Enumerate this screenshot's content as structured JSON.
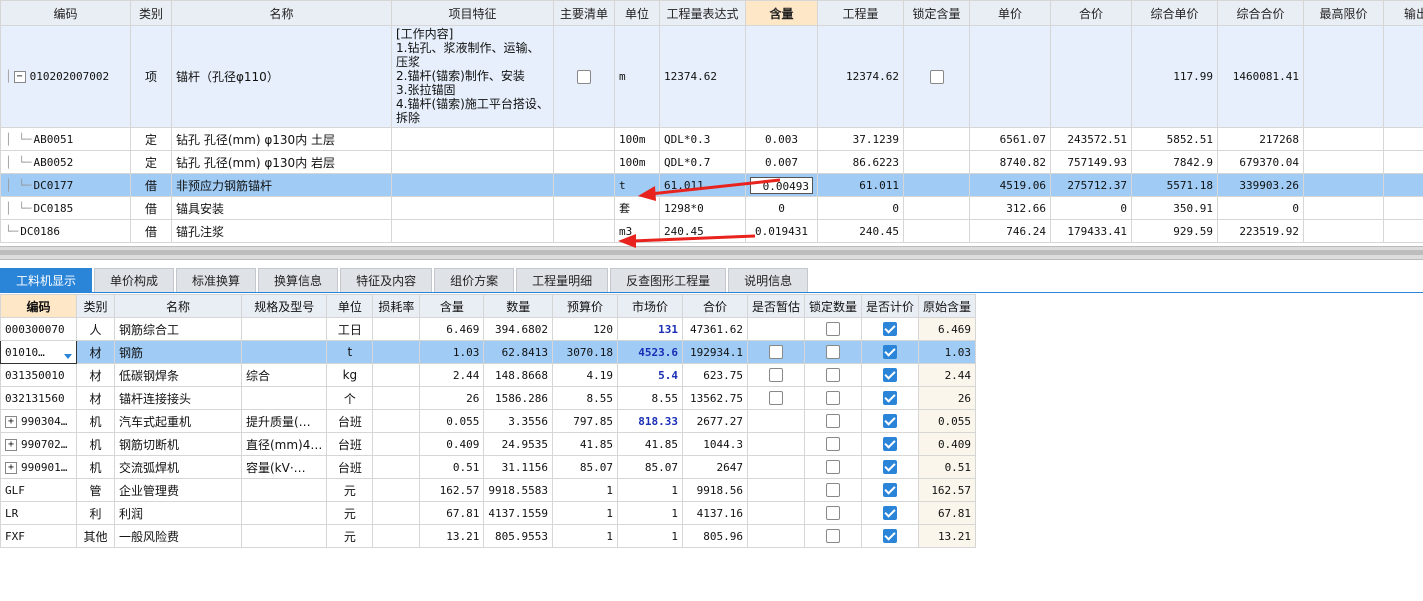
{
  "upper": {
    "headers": [
      "编码",
      "类别",
      "名称",
      "项目特征",
      "主要清单",
      "单位",
      "工程量表达式",
      "含量",
      "工程量",
      "锁定含量",
      "单价",
      "合价",
      "综合单价",
      "综合合价",
      "最高限价",
      "输出业"
    ],
    "parent": {
      "code": "010202007002",
      "type": "项",
      "name": "锚杆（孔径φ110）",
      "features": "[工作内容]\n1.钻孔、浆液制作、运输、压浆\n2.锚杆(锚索)制作、安装\n3.张拉锚固\n4.锚杆(锚索)施工平台搭设、拆除",
      "unit": "m",
      "expr": "12374.62",
      "qty": "12374.62",
      "comp_price": "117.99",
      "comp_total": "1460081.41"
    },
    "children": [
      {
        "code": "AB0051",
        "type": "定",
        "name": "钻孔 孔径(mm) φ130内 土层",
        "unit": "100m",
        "expr": "QDL*0.3",
        "content": "0.003",
        "qty": "37.1239",
        "price": "6561.07",
        "total": "243572.51",
        "comp_price": "5852.51",
        "comp_total": "217268"
      },
      {
        "code": "AB0052",
        "type": "定",
        "name": "钻孔 孔径(mm) φ130内 岩层",
        "unit": "100m",
        "expr": "QDL*0.7",
        "content": "0.007",
        "qty": "86.6223",
        "price": "8740.82",
        "total": "757149.93",
        "comp_price": "7842.9",
        "comp_total": "679370.04"
      },
      {
        "code": "DC0177",
        "type": "借",
        "name": "非预应力钢筋锚杆",
        "unit": "t",
        "expr": "61.011",
        "content": "0.00493",
        "qty": "61.011",
        "price": "4519.06",
        "total": "275712.37",
        "comp_price": "5571.18",
        "comp_total": "339903.26"
      },
      {
        "code": "DC0185",
        "type": "借",
        "name": "锚具安装",
        "unit": "套",
        "expr": "1298*0",
        "content": "0",
        "qty": "0",
        "price": "312.66",
        "total": "0",
        "comp_price": "350.91",
        "comp_total": "0"
      },
      {
        "code": "DC0186",
        "type": "借",
        "name": "锚孔注浆",
        "unit": "m3",
        "expr": "240.45",
        "content": "0.019431",
        "qty": "240.45",
        "price": "746.24",
        "total": "179433.41",
        "comp_price": "929.59",
        "comp_total": "223519.92"
      }
    ]
  },
  "tabs": [
    "工料机显示",
    "单价构成",
    "标准换算",
    "换算信息",
    "特征及内容",
    "组价方案",
    "工程量明细",
    "反查图形工程量",
    "说明信息"
  ],
  "lower": {
    "headers": [
      "编码",
      "类别",
      "名称",
      "规格及型号",
      "单位",
      "损耗率",
      "含量",
      "数量",
      "预算价",
      "市场价",
      "合价",
      "是否暂估",
      "锁定数量",
      "是否计价",
      "原始含量"
    ],
    "rows": [
      {
        "code": "000300070",
        "type": "人",
        "name": "钢筋综合工",
        "spec": "",
        "unit": "工日",
        "content": "6.469",
        "qty": "394.6802",
        "budget": "120",
        "market": "131",
        "total": "47361.62",
        "est": null,
        "orig": "6.469"
      },
      {
        "code": "01010…",
        "type": "材",
        "name": "钢筋",
        "spec": "",
        "unit": "t",
        "content": "1.03",
        "qty": "62.8413",
        "budget": "3070.18",
        "market": "4523.6",
        "total": "192934.1",
        "est": false,
        "orig": "1.03"
      },
      {
        "code": "031350010",
        "type": "材",
        "name": "低碳钢焊条",
        "spec": "综合",
        "unit": "kg",
        "content": "2.44",
        "qty": "148.8668",
        "budget": "4.19",
        "market": "5.4",
        "total": "623.75",
        "est": false,
        "orig": "2.44"
      },
      {
        "code": "032131560",
        "type": "材",
        "name": "锚杆连接接头",
        "spec": "",
        "unit": "个",
        "content": "26",
        "qty": "1586.286",
        "budget": "8.55",
        "market": "8.55",
        "total": "13562.75",
        "est": false,
        "orig": "26"
      },
      {
        "code": "990304…",
        "type": "机",
        "name": "汽车式起重机",
        "spec": "提升质量(…",
        "unit": "台班",
        "content": "0.055",
        "qty": "3.3556",
        "budget": "797.85",
        "market": "818.33",
        "total": "2677.27",
        "est": null,
        "orig": "0.055"
      },
      {
        "code": "990702…",
        "type": "机",
        "name": "钢筋切断机",
        "spec": "直径(mm)4…",
        "unit": "台班",
        "content": "0.409",
        "qty": "24.9535",
        "budget": "41.85",
        "market": "41.85",
        "total": "1044.3",
        "est": null,
        "orig": "0.409"
      },
      {
        "code": "990901…",
        "type": "机",
        "name": "交流弧焊机",
        "spec": "容量(kV·…",
        "unit": "台班",
        "content": "0.51",
        "qty": "31.1156",
        "budget": "85.07",
        "market": "85.07",
        "total": "2647",
        "est": null,
        "orig": "0.51"
      },
      {
        "code": "GLF",
        "type": "管",
        "name": "企业管理费",
        "spec": "",
        "unit": "元",
        "content": "162.57",
        "qty": "9918.5583",
        "budget": "1",
        "market": "1",
        "total": "9918.56",
        "est": null,
        "orig": "162.57"
      },
      {
        "code": "LR",
        "type": "利",
        "name": "利润",
        "spec": "",
        "unit": "元",
        "content": "67.81",
        "qty": "4137.1559",
        "budget": "1",
        "market": "1",
        "total": "4137.16",
        "est": null,
        "orig": "67.81"
      },
      {
        "code": "FXF",
        "type": "其他",
        "name": "一般风险费",
        "spec": "",
        "unit": "元",
        "content": "13.21",
        "qty": "805.9553",
        "budget": "1",
        "market": "1",
        "total": "805.96",
        "est": null,
        "orig": "13.21"
      }
    ]
  },
  "colors": {
    "accent": "#2a84d8",
    "selection": "#9fcbf5",
    "parent_row": "#e6effb",
    "highlight_header": "#fde7c6",
    "annotation_arrow": "#e8231d"
  }
}
